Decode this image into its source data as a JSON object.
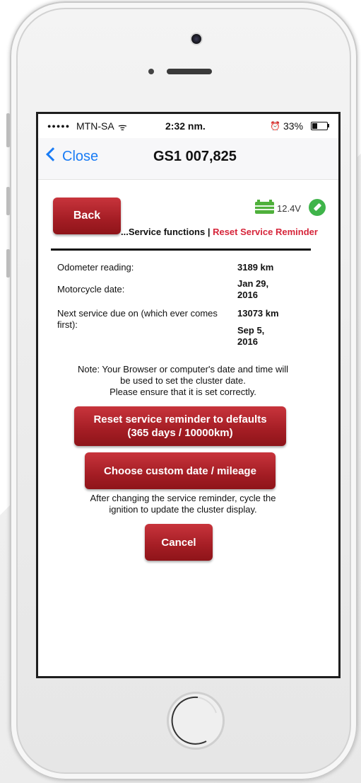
{
  "status": {
    "signal_dots": "●●●●●",
    "carrier": "MTN-SA",
    "wifi_glyph": "ᯤ",
    "time": "2:32 nm.",
    "alarm_glyph": "⏰",
    "battery_percent": "33%"
  },
  "nav": {
    "close_label": "Close",
    "title": "GS1 007,825"
  },
  "header": {
    "back_label": "Back",
    "voltage": "12.4V",
    "breadcrumb_prefix": "...Service functions | ",
    "breadcrumb_current": "Reset Service Reminder"
  },
  "info": {
    "odometer_label": "Odometer reading:",
    "odometer_value": "3189 km",
    "date_label": "Motorcycle date:",
    "date_value_1": "Jan 29,",
    "date_value_2": "2016",
    "next_label_1": "Next service due on (which ever comes",
    "next_label_2": "first):",
    "next_km": "13073 km",
    "next_date_1": "Sep 5,",
    "next_date_2": "2016"
  },
  "note": {
    "line1": "Note: Your Browser or computer's date and time will",
    "line2": "be used to set the cluster date.",
    "line3": "Please ensure that it is set correctly."
  },
  "actions": {
    "reset_line1": "Reset service reminder to defaults",
    "reset_line2": "(365 days / 10000km)",
    "custom_label": "Choose custom date / mileage",
    "hint_line1": "After changing the service reminder, cycle the",
    "hint_line2": "ignition to update the cluster display.",
    "cancel_label": "Cancel"
  },
  "colors": {
    "accent_red": "#d6253a",
    "button_red": "#a41d24",
    "ios_blue": "#1a7cf5",
    "battery_green": "#4fb03b"
  }
}
